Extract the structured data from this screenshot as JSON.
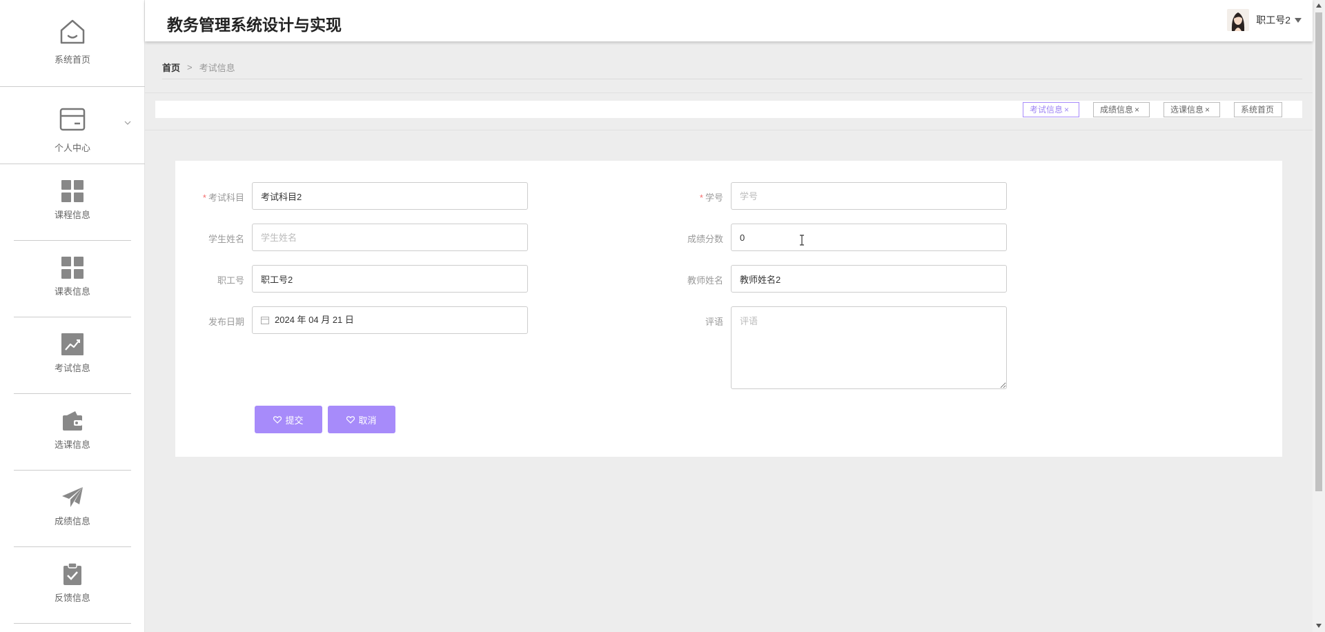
{
  "app": {
    "title": "教务管理系统设计与实现"
  },
  "user": {
    "name": "职工号2"
  },
  "sidebar": {
    "home": "系统首页",
    "personal": "个人中心",
    "items": [
      {
        "label": "课程信息",
        "icon": "grid-icon"
      },
      {
        "label": "课表信息",
        "icon": "grid-icon"
      },
      {
        "label": "考试信息",
        "icon": "chart-icon"
      },
      {
        "label": "选课信息",
        "icon": "wallet-icon"
      },
      {
        "label": "成绩信息",
        "icon": "send-icon"
      },
      {
        "label": "反馈信息",
        "icon": "clipboard-check-icon"
      }
    ]
  },
  "breadcrumb": {
    "home": "首页",
    "separator": ">",
    "current": "考试信息"
  },
  "tags": [
    {
      "label": "考试信息",
      "close": "×",
      "active": true
    },
    {
      "label": "成绩信息",
      "close": "×",
      "active": false
    },
    {
      "label": "选课信息",
      "close": "×",
      "active": false
    },
    {
      "label": "系统首页",
      "close": "",
      "active": false
    }
  ],
  "form": {
    "subject": {
      "label": "考试科目",
      "value": "考试科目2",
      "required": true
    },
    "student_no": {
      "label": "学号",
      "value": "",
      "placeholder": "学号",
      "required": true
    },
    "student_name": {
      "label": "学生姓名",
      "value": "",
      "placeholder": "学生姓名"
    },
    "score": {
      "label": "成绩分数",
      "value": "0"
    },
    "staff_no": {
      "label": "职工号",
      "value": "职工号2"
    },
    "teacher_name": {
      "label": "教师姓名",
      "value": "教师姓名2"
    },
    "publish_date": {
      "label": "发布日期",
      "value": "2024 年 04 月 21 日"
    },
    "comment": {
      "label": "评语",
      "value": "",
      "placeholder": "评语"
    },
    "required_mark": "*",
    "submit_label": "提交",
    "cancel_label": "取消"
  },
  "colors": {
    "accent": "#a78bfa",
    "required": "#f56c6c"
  }
}
